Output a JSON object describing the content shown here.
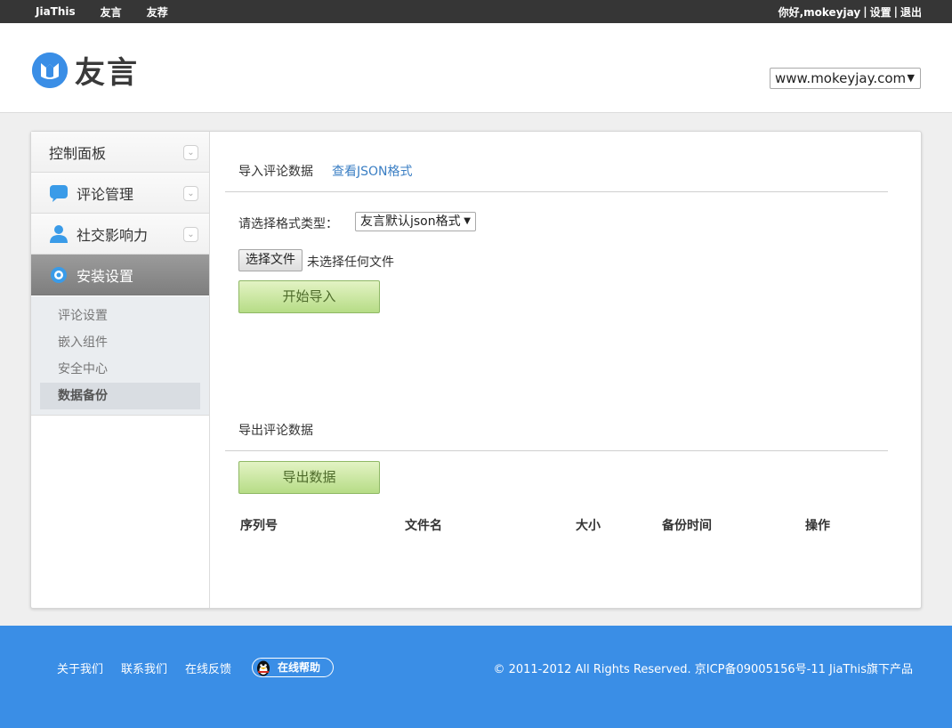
{
  "topbar": {
    "nav": [
      "JiaThis",
      "友言",
      "友荐"
    ],
    "greeting": "你好,mokeyjay",
    "separator": "|",
    "settings": "设置",
    "logout": "退出"
  },
  "header": {
    "logo_text": "友言",
    "site_select": "www.mokeyjay.com"
  },
  "sidebar": {
    "items": [
      {
        "label": "控制面板",
        "icon": "dashboard-icon"
      },
      {
        "label": "评论管理",
        "icon": "comment-bubble-icon"
      },
      {
        "label": "社交影响力",
        "icon": "user-icon"
      },
      {
        "label": "安装设置",
        "icon": "gear-icon"
      }
    ],
    "sub_items": [
      "评论设置",
      "嵌入组件",
      "安全中心",
      "数据备份"
    ],
    "current_sub": "数据备份"
  },
  "import": {
    "title": "导入评论数据",
    "json_link": "查看JSON格式",
    "format_label": "请选择格式类型：",
    "format_value": "友言默认json格式",
    "file_button": "选择文件",
    "file_status": "未选择任何文件",
    "start_button": "开始导入"
  },
  "export": {
    "title": "导出评论数据",
    "export_button": "导出数据",
    "columns": [
      "序列号",
      "文件名",
      "大小",
      "备份时间",
      "操作"
    ]
  },
  "footer": {
    "links": [
      "关于我们",
      "联系我们",
      "在线反馈"
    ],
    "help": "在线帮助",
    "copyright": "© 2011-2012 All Rights Reserved. 京ICP备09005156号-11 JiaThis旗下产品"
  },
  "colors": {
    "topbar": "#363636",
    "accent_blue": "#3a8ee6",
    "link": "#3b7fc4",
    "green_button": "#b6dc86"
  }
}
